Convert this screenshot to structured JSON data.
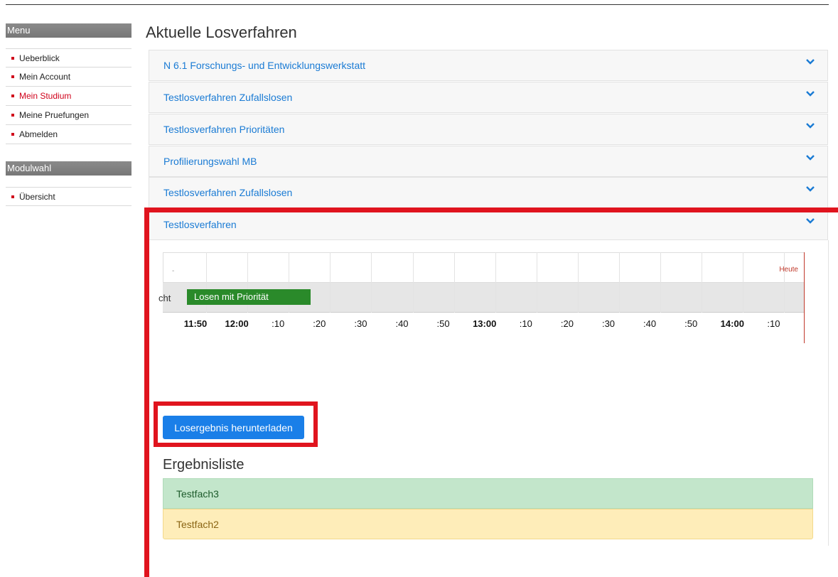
{
  "sidebar": {
    "menu_heading": "Menu",
    "menu_items": [
      {
        "label": "Ueberblick",
        "active": false
      },
      {
        "label": "Mein Account",
        "active": false
      },
      {
        "label": "Mein Studium",
        "active": true
      },
      {
        "label": "Meine Pruefungen",
        "active": false
      },
      {
        "label": "Abmelden",
        "active": false
      }
    ],
    "modulwahl_heading": "Modulwahl",
    "modulwahl_items": [
      {
        "label": "Übersicht"
      }
    ]
  },
  "main": {
    "title": "Aktuelle Losverfahren",
    "panels": [
      {
        "title": "N 6.1 Forschungs- und Entwicklungswerkstatt"
      },
      {
        "title": "Testlosverfahren Zufallslosen"
      },
      {
        "title": "Testlosverfahren Prioritäten"
      },
      {
        "title": "Profilierungswahl MB"
      },
      {
        "title": "Testlosverfahren Zufallslosen"
      },
      {
        "title": "Testlosverfahren"
      }
    ],
    "timeline": {
      "today_label": "Heute",
      "placeholder_label": "-",
      "row_label": "cht",
      "bar_label": "Losen mit Priorität",
      "ticks": [
        {
          "label": "11:50",
          "bold": true
        },
        {
          "label": "12:00",
          "bold": true
        },
        {
          "label": ":10",
          "bold": false
        },
        {
          "label": ":20",
          "bold": false
        },
        {
          "label": ":30",
          "bold": false
        },
        {
          "label": ":40",
          "bold": false
        },
        {
          "label": ":50",
          "bold": false
        },
        {
          "label": "13:00",
          "bold": true
        },
        {
          "label": ":10",
          "bold": false
        },
        {
          "label": ":20",
          "bold": false
        },
        {
          "label": ":30",
          "bold": false
        },
        {
          "label": ":40",
          "bold": false
        },
        {
          "label": ":50",
          "bold": false
        },
        {
          "label": "14:00",
          "bold": true
        },
        {
          "label": ":10",
          "bold": false
        }
      ]
    },
    "download_button": "Losergebnis herunterladen",
    "results_title": "Ergebnisliste",
    "results": [
      {
        "label": "Testfach3",
        "status": "success"
      },
      {
        "label": "Testfach2",
        "status": "warning"
      }
    ]
  },
  "colors": {
    "accent_red": "#d0021b",
    "link_blue": "#1a7bd4",
    "button_blue": "#1a7fe8",
    "bar_green": "#2a8a2a",
    "highlight_red": "#e0141e"
  }
}
